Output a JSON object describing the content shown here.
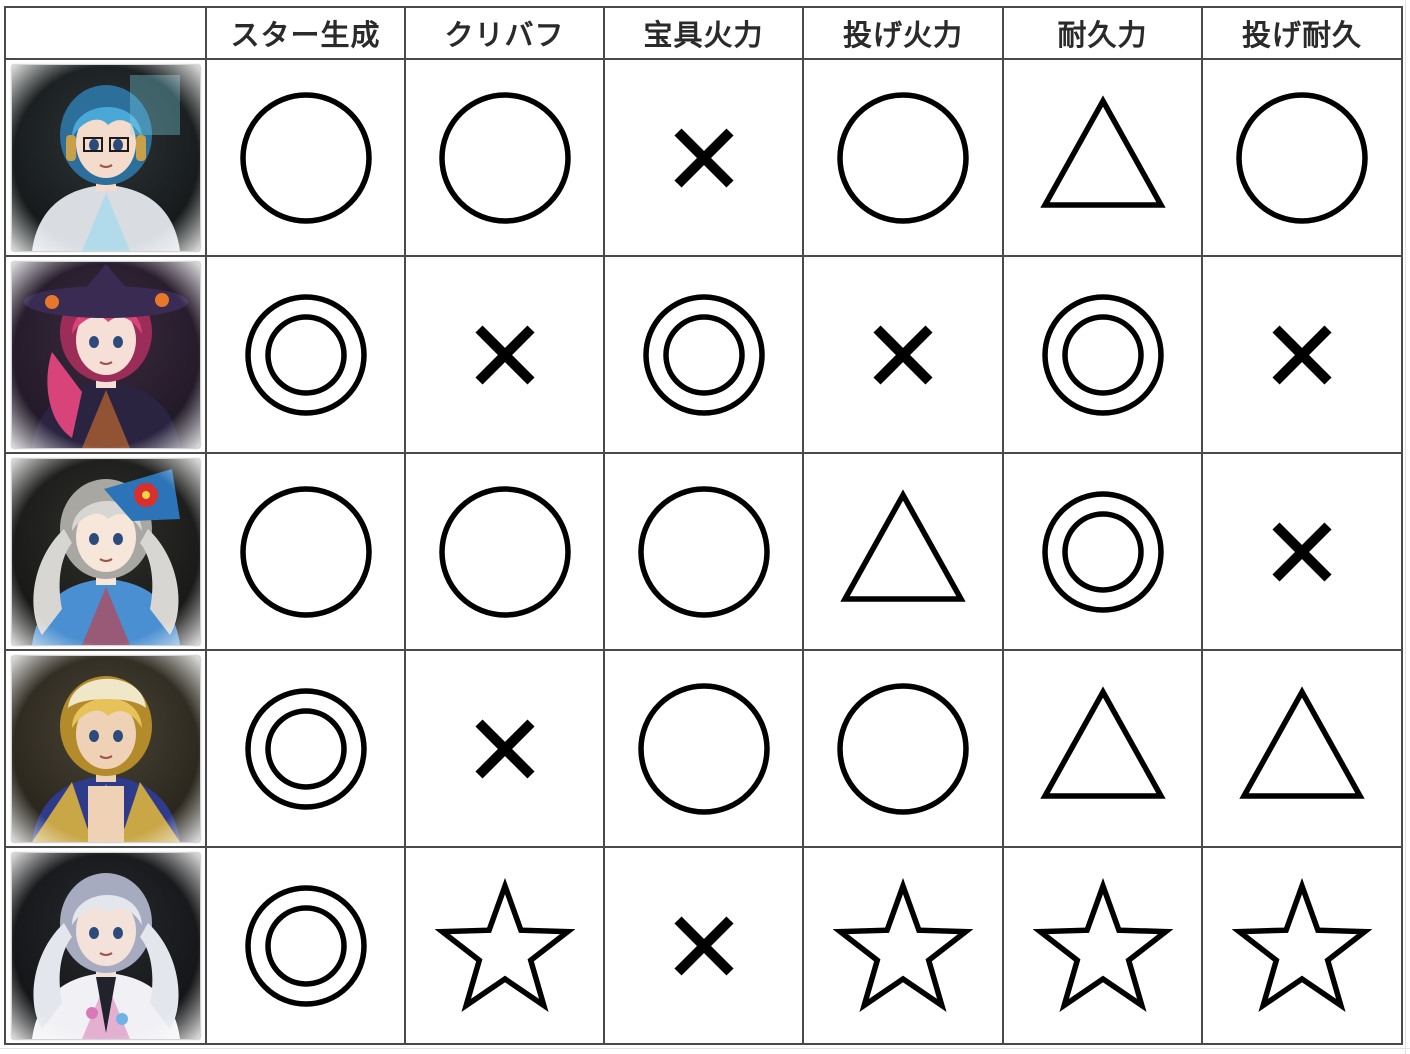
{
  "columns": [
    {
      "key": "star_gen",
      "label": "スター生成"
    },
    {
      "key": "crit_buff",
      "label": "クリバフ"
    },
    {
      "key": "np_damage",
      "label": "宝具火力"
    },
    {
      "key": "throw_damage",
      "label": "投げ火力"
    },
    {
      "key": "durability",
      "label": "耐久力"
    },
    {
      "key": "throw_durability",
      "label": "投げ耐久"
    }
  ],
  "rows": [
    {
      "portrait": "servant-portrait-blue-hair-glasses-headphones",
      "ratings": [
        "circle",
        "circle",
        "cross",
        "circle",
        "triangle",
        "circle"
      ]
    },
    {
      "portrait": "servant-portrait-pink-hair-witch-hat",
      "ratings": [
        "double-circle",
        "cross",
        "double-circle",
        "cross",
        "double-circle",
        "cross"
      ]
    },
    {
      "portrait": "servant-portrait-white-hair-swimsuit",
      "ratings": [
        "circle",
        "circle",
        "circle",
        "triangle",
        "double-circle",
        "cross"
      ]
    },
    {
      "portrait": "servant-portrait-blond-hair-caster",
      "ratings": [
        "double-circle",
        "cross",
        "circle",
        "circle",
        "triangle",
        "triangle"
      ]
    },
    {
      "portrait": "servant-portrait-white-hair-mage",
      "ratings": [
        "double-circle",
        "star",
        "cross",
        "star",
        "star",
        "star"
      ]
    }
  ],
  "colors": {
    "grid_line": "#4a4a4a",
    "symbol_stroke": "#000000",
    "header_text": "#2a2a2a"
  }
}
